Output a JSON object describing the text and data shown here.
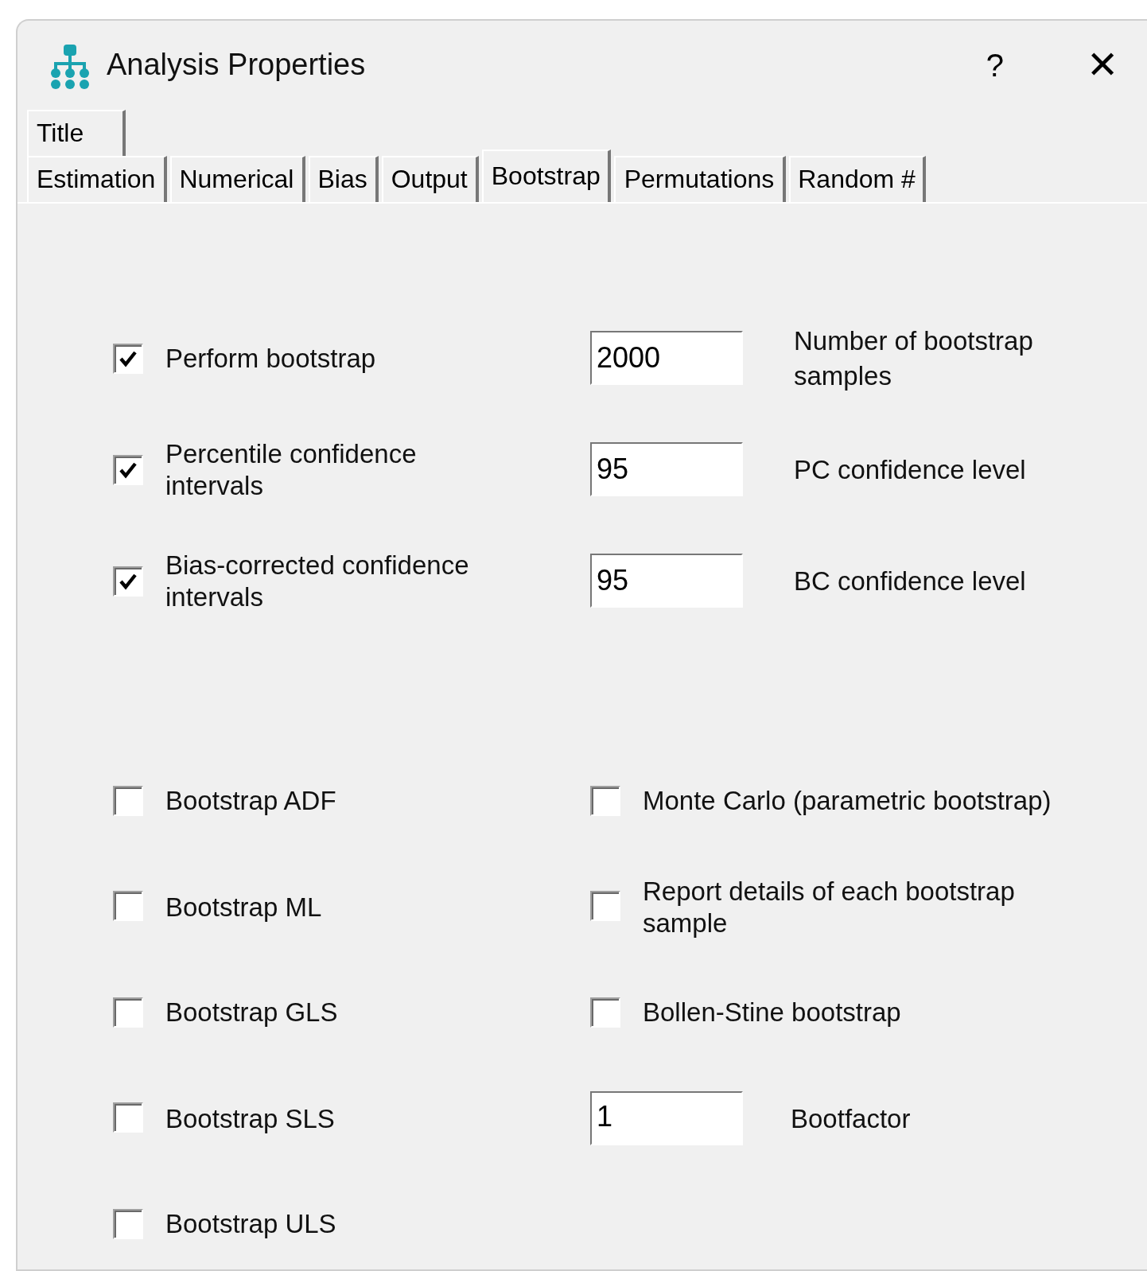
{
  "window": {
    "title": "Analysis Properties",
    "help": "?",
    "close": "✕"
  },
  "tab_rows": [
    [
      {
        "label": "Title",
        "selected": false
      }
    ],
    [
      {
        "label": "Estimation",
        "selected": false
      },
      {
        "label": "Numerical",
        "selected": false
      },
      {
        "label": "Bias",
        "selected": false
      },
      {
        "label": "Output",
        "selected": false
      },
      {
        "label": "Bootstrap",
        "selected": true
      },
      {
        "label": "Permutations",
        "selected": false
      },
      {
        "label": "Random #",
        "selected": false
      }
    ]
  ],
  "top_rows": [
    {
      "checkbox": {
        "label": "Perform bootstrap",
        "checked": true
      },
      "field": {
        "value": "2000",
        "label": "Number of bootstrap samples"
      }
    },
    {
      "checkbox": {
        "label": "Percentile confidence intervals",
        "checked": true
      },
      "field": {
        "value": "95",
        "label": "PC confidence level"
      }
    },
    {
      "checkbox": {
        "label": "Bias-corrected confidence intervals",
        "checked": true
      },
      "field": {
        "value": "95",
        "label": "BC confidence level"
      }
    }
  ],
  "left_options": [
    {
      "label": "Bootstrap ADF",
      "checked": false
    },
    {
      "label": "Bootstrap ML",
      "checked": false
    },
    {
      "label": "Bootstrap GLS",
      "checked": false
    },
    {
      "label": "Bootstrap SLS",
      "checked": false
    },
    {
      "label": "Bootstrap ULS",
      "checked": false
    }
  ],
  "right_options": [
    {
      "kind": "checkbox",
      "label": "Monte Carlo (parametric bootstrap)",
      "checked": false
    },
    {
      "kind": "checkbox",
      "label": "Report details of each bootstrap sample",
      "checked": false
    },
    {
      "kind": "checkbox",
      "label": "Bollen-Stine bootstrap",
      "checked": false
    },
    {
      "kind": "field",
      "value": "1",
      "label": "Bootfactor"
    }
  ]
}
